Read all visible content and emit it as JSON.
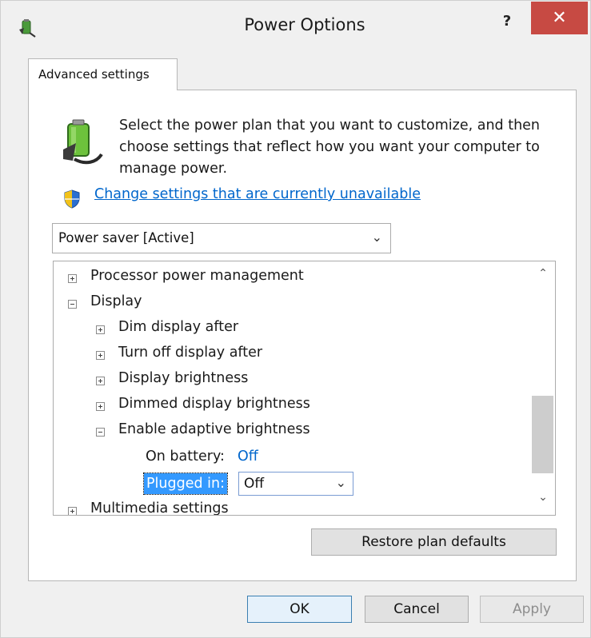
{
  "window": {
    "title": "Power Options",
    "help_label": "?",
    "close_label": "✕"
  },
  "tab": {
    "label": "Advanced settings"
  },
  "description": "Select the power plan that you want to customize, and then choose settings that reflect how you want your computer to manage power.",
  "change_link": "Change settings that are currently unavailable",
  "plan_select": {
    "value": "Power saver [Active]"
  },
  "tree": {
    "processor": "Processor power management",
    "display": "Display",
    "dim_display": "Dim display after",
    "turn_off_display": "Turn off display after",
    "display_brightness": "Display brightness",
    "dimmed_brightness": "Dimmed display brightness",
    "adaptive_brightness": "Enable adaptive brightness",
    "on_battery_label": "On battery:",
    "on_battery_value": "Off",
    "plugged_in_label": "Plugged in:",
    "plugged_in_value": "Off",
    "multimedia": "Multimedia settings"
  },
  "buttons": {
    "restore": "Restore plan defaults",
    "ok": "OK",
    "cancel": "Cancel",
    "apply": "Apply"
  },
  "icons": {
    "app": "power-options-icon",
    "battery": "battery-plug-icon",
    "shield": "uac-shield-icon"
  },
  "colors": {
    "close_button": "#c74a43",
    "link": "#0066cc",
    "selection": "#3399ff"
  }
}
